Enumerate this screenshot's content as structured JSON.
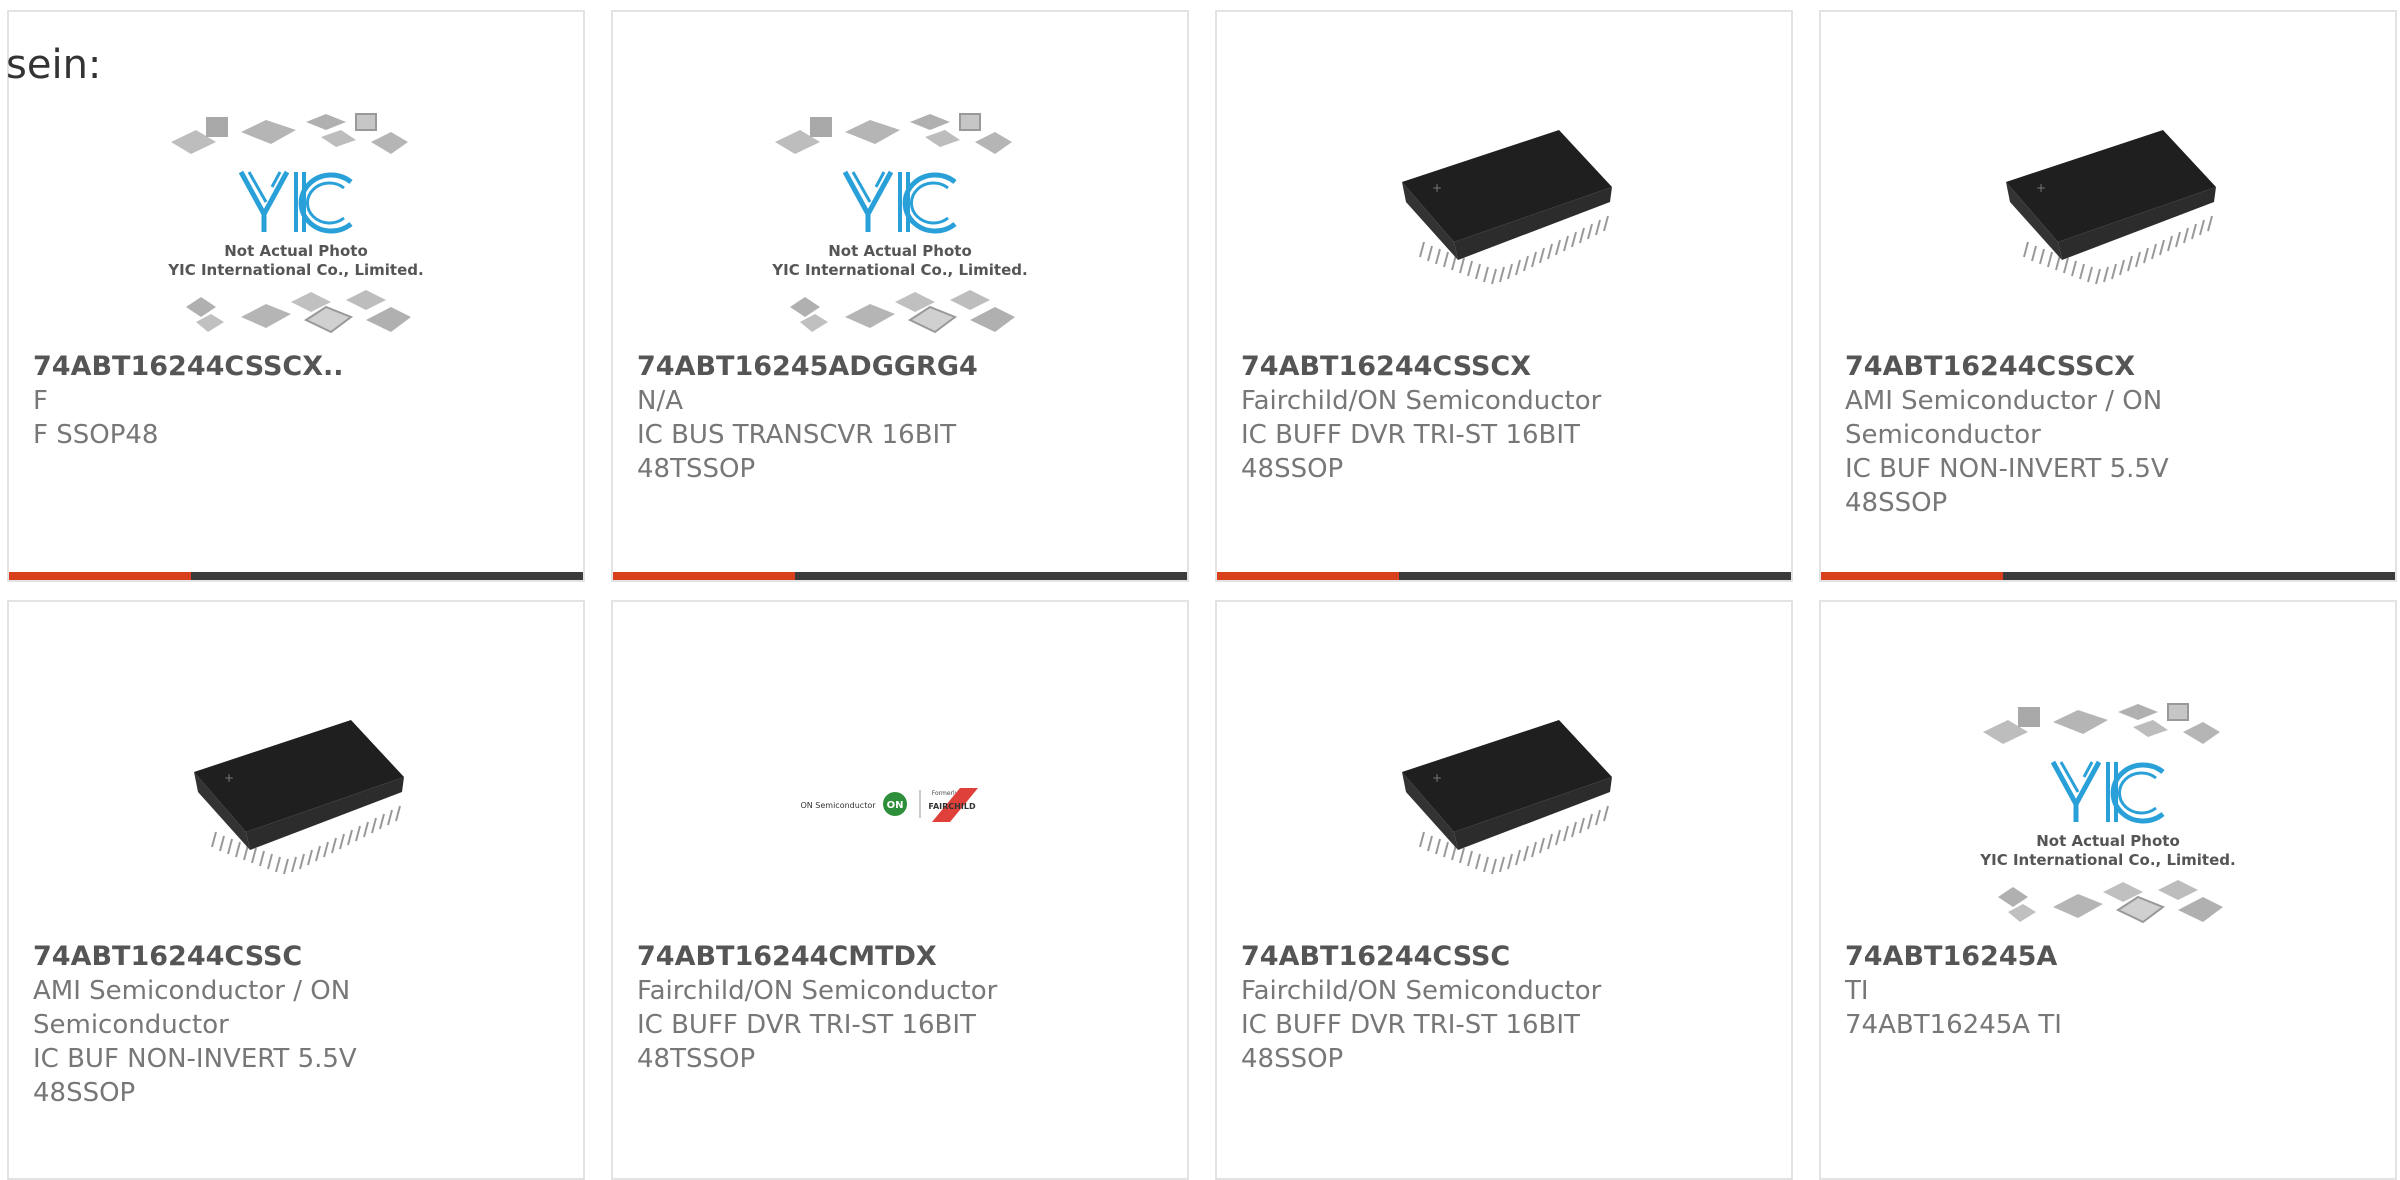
{
  "header": {
    "label": "sein:"
  },
  "colors": {
    "accent": "#d9401c",
    "bar": "#3b3b3b",
    "border": "#e3e3e3",
    "logo_blue": "#2aa0d8",
    "fairchild_red": "#e0403a",
    "on_green": "#2d8f3a"
  },
  "products": [
    {
      "part": "74ABT16244CSSCX..",
      "lines": [
        "F",
        "F SSOP48"
      ],
      "image": "yic-placeholder-icon",
      "placeholder_text": [
        "Not Actual Photo",
        "YIC International Co., Limited."
      ]
    },
    {
      "part": "74ABT16245ADGGRG4",
      "lines": [
        "N/A",
        "IC BUS TRANSCVR 16BIT",
        "48TSSOP"
      ],
      "image": "yic-placeholder-icon",
      "placeholder_text": [
        "Not Actual Photo",
        "YIC International Co., Limited."
      ]
    },
    {
      "part": "74ABT16244CSSCX",
      "lines": [
        "Fairchild/ON Semiconductor",
        "IC BUFF DVR TRI-ST 16BIT",
        "48SSOP"
      ],
      "image": "ssop-chip-icon"
    },
    {
      "part": "74ABT16244CSSCX",
      "lines": [
        "AMI Semiconductor / ON",
        "Semiconductor",
        "IC BUF NON-INVERT 5.5V",
        "48SSOP"
      ],
      "image": "ssop-chip-icon"
    },
    {
      "part": "74ABT16244CSSC",
      "lines": [
        "AMI Semiconductor / ON",
        "Semiconductor",
        "IC BUF NON-INVERT 5.5V",
        "48SSOP"
      ],
      "image": "ssop-chip-icon"
    },
    {
      "part": "74ABT16244CMTDX",
      "lines": [
        "Fairchild/ON Semiconductor",
        "IC BUFF DVR TRI-ST 16BIT",
        "48TSSOP"
      ],
      "image": "on-fairchild-logo",
      "logo_text": [
        "ON Semiconductor",
        "ON",
        "Formerly",
        "FAIRCHILD"
      ]
    },
    {
      "part": "74ABT16244CSSC",
      "lines": [
        "Fairchild/ON Semiconductor",
        "IC BUFF DVR TRI-ST 16BIT",
        "48SSOP"
      ],
      "image": "ssop-chip-icon"
    },
    {
      "part": "74ABT16245A",
      "lines": [
        "TI",
        "74ABT16245A TI"
      ],
      "image": "yic-placeholder-icon",
      "placeholder_text": [
        "Not Actual Photo",
        "YIC International Co., Limited."
      ]
    }
  ]
}
